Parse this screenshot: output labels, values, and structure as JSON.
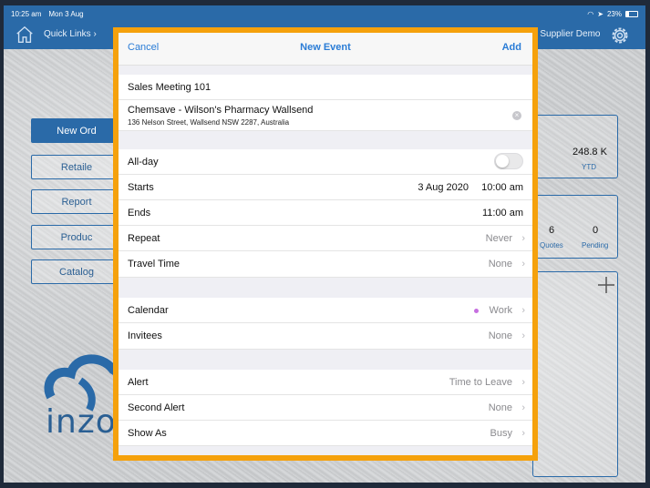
{
  "status_bar": {
    "time": "10:25 am",
    "date": "Mon 3 Aug",
    "battery": "23%"
  },
  "app_bar": {
    "quick_links": "Quick Links ›",
    "supplier_suffix": "e Supplier Demo"
  },
  "left_menu": [
    "New Ord",
    "Retaile",
    "Report",
    "Produc",
    "Catalog"
  ],
  "logo_text": "inzo",
  "stats": {
    "ytd_value": "248.8 K",
    "ytd_label": "YTD",
    "quotes_value": "6",
    "quotes_label": "Quotes",
    "pending_value": "0",
    "pending_label": "Pending"
  },
  "modal": {
    "cancel": "Cancel",
    "title": "New Event",
    "add": "Add",
    "event_title": "Sales Meeting 101",
    "location_name": "Chemsave - Wilson's Pharmacy Wallsend",
    "location_address": "136 Nelson Street, Wallsend NSW 2287, Australia",
    "all_day": {
      "label": "All-day",
      "on": false
    },
    "starts": {
      "label": "Starts",
      "date": "3 Aug 2020",
      "time": "10:00 am"
    },
    "ends": {
      "label": "Ends",
      "time": "11:00 am"
    },
    "repeat": {
      "label": "Repeat",
      "value": "Never"
    },
    "travel_time": {
      "label": "Travel Time",
      "value": "None"
    },
    "calendar": {
      "label": "Calendar",
      "value": "Work",
      "dot_color": "#c66fe0"
    },
    "invitees": {
      "label": "Invitees",
      "value": "None"
    },
    "alert": {
      "label": "Alert",
      "value": "Time to Leave"
    },
    "second_alert": {
      "label": "Second Alert",
      "value": "None"
    },
    "show_as": {
      "label": "Show As",
      "value": "Busy"
    }
  },
  "colors": {
    "brand_blue": "#2a6aa8",
    "highlight_orange": "#f5a10c",
    "ios_blue": "#2a7cd6"
  }
}
